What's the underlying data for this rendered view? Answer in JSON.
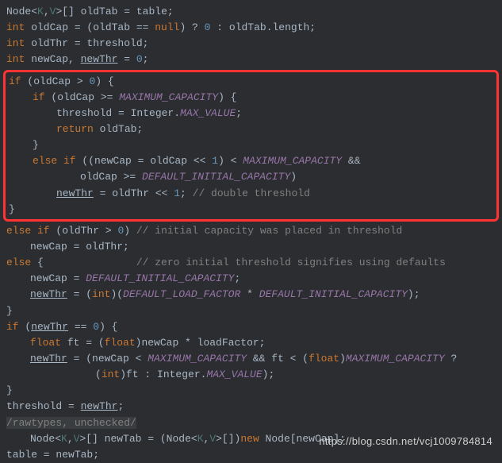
{
  "code": {
    "line1_a": "Node<",
    "line1_b": "K",
    "line1_c": ",",
    "line1_d": "V",
    "line1_e": ">[] oldTab = table;",
    "line2_a": "int",
    "line2_b": " oldCap = (oldTab == ",
    "line2_c": "null",
    "line2_d": ") ? ",
    "line2_e": "0",
    "line2_f": " : oldTab.length;",
    "line3_a": "int",
    "line3_b": " oldThr = threshold;",
    "line4_a": "int",
    "line4_b": " newCap, ",
    "line4_c": "newThr",
    "line4_d": " = ",
    "line4_e": "0",
    "line4_f": ";",
    "line5_a": "if",
    "line5_b": " (oldCap > ",
    "line5_c": "0",
    "line5_d": ") {",
    "line6_a": "if",
    "line6_b": " (oldCap >= ",
    "line6_c": "MAXIMUM_CAPACITY",
    "line6_d": ") {",
    "line7_a": "threshold = Integer.",
    "line7_b": "MAX_VALUE",
    "line7_c": ";",
    "line8_a": "return",
    "line8_b": " oldTab;",
    "line9": "}",
    "line10_a": "else if",
    "line10_b": " ((newCap = oldCap << ",
    "line10_c": "1",
    "line10_d": ") < ",
    "line10_e": "MAXIMUM_CAPACITY",
    "line10_f": " &&",
    "line11_a": "oldCap >= ",
    "line11_b": "DEFAULT_INITIAL_CAPACITY",
    "line11_c": ")",
    "line12_a": "newThr",
    "line12_b": " = oldThr << ",
    "line12_c": "1",
    "line12_d": "; ",
    "line12_e": "// double threshold",
    "line13": "}",
    "line14_a": "else if",
    "line14_b": " (oldThr > ",
    "line14_c": "0",
    "line14_d": ") ",
    "line14_e": "// initial capacity was placed in threshold",
    "line15": "newCap = oldThr;",
    "line16_a": "else",
    "line16_b": " {               ",
    "line16_c": "// zero initial threshold signifies using defaults",
    "line17_a": "newCap = ",
    "line17_b": "DEFAULT_INITIAL_CAPACITY",
    "line17_c": ";",
    "line18_a": "newThr",
    "line18_b": " = (",
    "line18_c": "int",
    "line18_d": ")(",
    "line18_e": "DEFAULT_LOAD_FACTOR",
    "line18_f": " * ",
    "line18_g": "DEFAULT_INITIAL_CAPACITY",
    "line18_h": ");",
    "line19": "}",
    "line20_a": "if",
    "line20_b": " (",
    "line20_c": "newThr",
    "line20_d": " == ",
    "line20_e": "0",
    "line20_f": ") {",
    "line21_a": "float",
    "line21_b": " ft = (",
    "line21_c": "float",
    "line21_d": ")newCap * loadFactor;",
    "line22_a": "newThr",
    "line22_b": " = (newCap < ",
    "line22_c": "MAXIMUM_CAPACITY",
    "line22_d": " && ft < (",
    "line22_e": "float",
    "line22_f": ")",
    "line22_g": "MAXIMUM_CAPACITY",
    "line22_h": " ?",
    "line23_a": "(",
    "line23_b": "int",
    "line23_c": ")ft : Integer.",
    "line23_d": "MAX_VALUE",
    "line23_e": ");",
    "line24": "}",
    "line25_a": "threshold = ",
    "line25_b": "newThr",
    "line25_c": ";",
    "line26": "/rawtypes, unchecked/",
    "line27_a": "Node<",
    "line27_b": "K",
    "line27_c": ",",
    "line27_d": "V",
    "line27_e": ">[] newTab = (Node<",
    "line27_f": "K",
    "line27_g": ",",
    "line27_h": "V",
    "line27_i": ">[])",
    "line27_j": "new",
    "line27_k": " Node[newCap];",
    "line28": "table = newTab;"
  },
  "watermark": "https://blog.csdn.net/vcj1009784814"
}
